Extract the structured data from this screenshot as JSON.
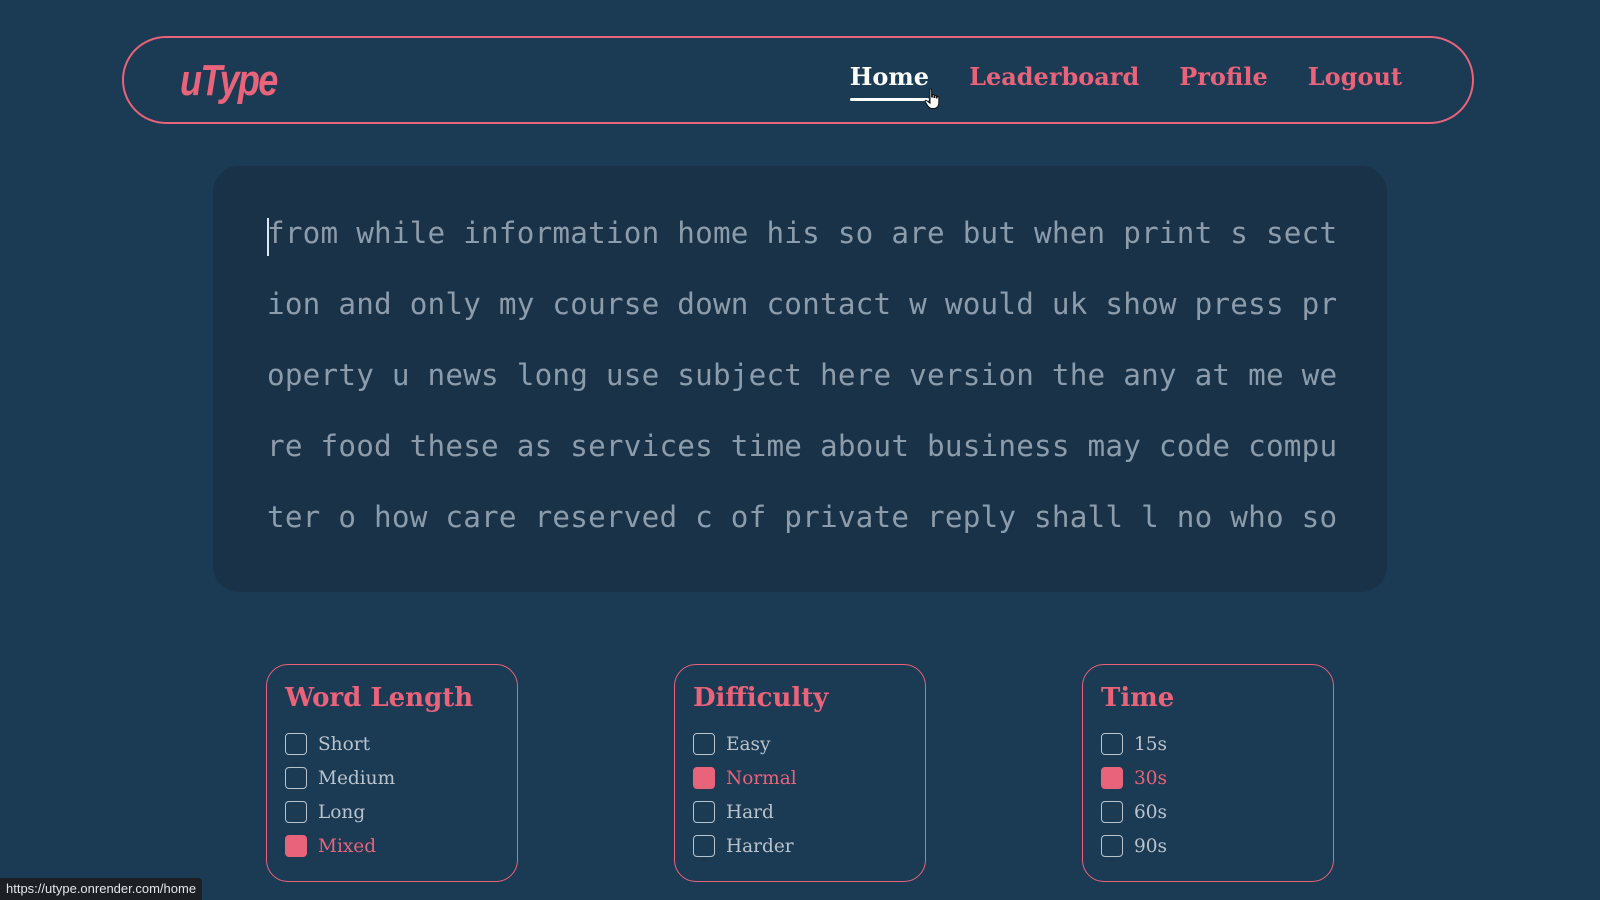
{
  "nav": {
    "logo": "uType",
    "links": [
      "Home",
      "Leaderboard",
      "Profile",
      "Logout"
    ],
    "active": "Home"
  },
  "typing": {
    "lines": [
      "from while information home his so are but when print s sect",
      "ion and only my course down contact w would uk show press pr",
      "operty u news long use subject here version the any at me we",
      "re food these as services time about business may code compu",
      "ter o how care reserved c of private reply shall l no who so"
    ]
  },
  "panels": [
    {
      "title": "Word Length",
      "options": [
        {
          "label": "Short",
          "checked": false
        },
        {
          "label": "Medium",
          "checked": false
        },
        {
          "label": "Long",
          "checked": false
        },
        {
          "label": "Mixed",
          "checked": true
        }
      ]
    },
    {
      "title": "Difficulty",
      "options": [
        {
          "label": "Easy",
          "checked": false
        },
        {
          "label": "Normal",
          "checked": true
        },
        {
          "label": "Hard",
          "checked": false
        },
        {
          "label": "Harder",
          "checked": false
        }
      ]
    },
    {
      "title": "Time",
      "options": [
        {
          "label": "15s",
          "checked": false
        },
        {
          "label": "30s",
          "checked": true
        },
        {
          "label": "60s",
          "checked": false
        },
        {
          "label": "90s",
          "checked": false
        }
      ]
    }
  ],
  "status_bar": {
    "url": "https://utype.onrender.com/home"
  },
  "colors": {
    "background": "#1b3a54",
    "accent": "#e9637a",
    "typing_box": "#193248",
    "text_muted": "#8d9caa"
  },
  "icons": {
    "pointer": "hand-pointer-icon"
  }
}
